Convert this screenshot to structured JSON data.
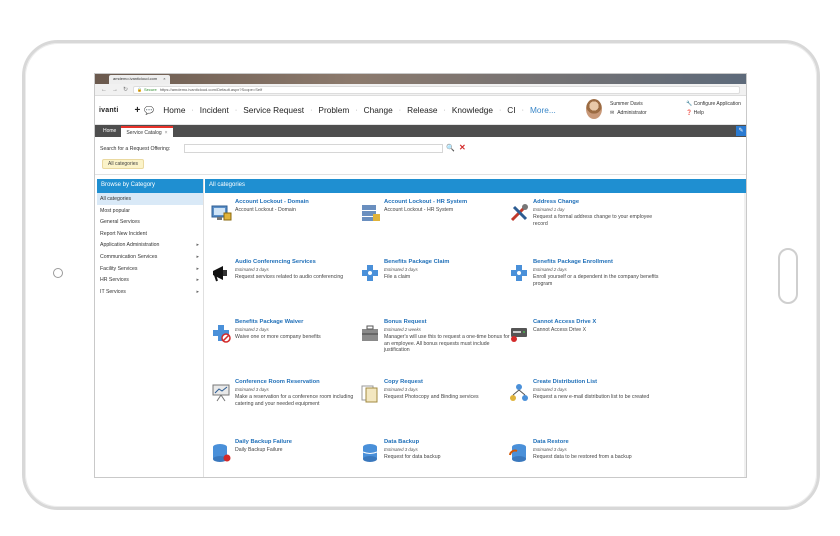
{
  "browser": {
    "tab_title": "amdemo.ivanticloud.com",
    "url_secure": "Secure",
    "url": "https://amdemo.ivanticloud.com/Default.aspx?Scope=Self"
  },
  "header": {
    "logo": "ivanti",
    "menu": [
      "Home",
      "Incident",
      "Service Request",
      "Problem",
      "Change",
      "Release",
      "Knowledge",
      "CI"
    ],
    "more": "More...",
    "user_name": "Summer Davis",
    "user_role": "Administrator",
    "configure": "Configure Application",
    "help": "Help"
  },
  "tabs": [
    {
      "label": "Home",
      "active": false
    },
    {
      "label": "Service Catalog",
      "active": true
    }
  ],
  "search": {
    "label": "Search for a Request Offering:",
    "value": "",
    "chip": "All categories"
  },
  "sidebar": {
    "title": "Browse by Category",
    "items": [
      {
        "label": "All categories",
        "selected": true,
        "arrow": false
      },
      {
        "label": "Most popular",
        "arrow": false
      },
      {
        "label": "General Services",
        "arrow": false
      },
      {
        "label": "Report New Incident",
        "arrow": false
      },
      {
        "label": "Application Administration",
        "arrow": true
      },
      {
        "label": "Communication Services",
        "arrow": true
      },
      {
        "label": "Facility Services",
        "arrow": true
      },
      {
        "label": "HR Services",
        "arrow": true
      },
      {
        "label": "IT Services",
        "arrow": true
      }
    ]
  },
  "main": {
    "title": "All categories",
    "offerings": [
      {
        "title": "Account Lockout - Domain",
        "est": "",
        "desc": "Account Lockout - Domain",
        "icon": "monitor-lock-icon"
      },
      {
        "title": "Account Lockout - HR System",
        "est": "",
        "desc": "Account Lockout - HR System",
        "icon": "server-lock-icon"
      },
      {
        "title": "Address Change",
        "est": "Estimated 1 day",
        "desc": "Request a formal address change to your employee record",
        "icon": "tools-icon"
      },
      {
        "title": "Audio Conferencing Services",
        "est": "Estimated 3 days",
        "desc": "Request services related to audio conferencing",
        "icon": "megaphone-icon"
      },
      {
        "title": "Benefits Package Claim",
        "est": "Estimated 3 days",
        "desc": "File a claim",
        "icon": "medical-icon"
      },
      {
        "title": "Benefits Package Enrollment",
        "est": "Estimated 2 days",
        "desc": "Enroll yourself or a dependent in the company benefits program",
        "icon": "medical-icon"
      },
      {
        "title": "Benefits Package Waiver",
        "est": "Estimated 2 days",
        "desc": "Waive one or more company benefits",
        "icon": "medical-cancel-icon"
      },
      {
        "title": "Bonus Request",
        "est": "Estimated 2 weeks",
        "desc": "Manager's will use this to request a one-time bonus for an employee. All bonus requests must include justification",
        "icon": "briefcase-icon"
      },
      {
        "title": "Cannot Access Drive X",
        "est": "",
        "desc": "Cannot Access Drive X",
        "icon": "drive-icon"
      },
      {
        "title": "Conference Room Reservation",
        "est": "Estimated 3 days",
        "desc": "Make a reservation for a conference room including catering and your needed equipment",
        "icon": "presentation-icon"
      },
      {
        "title": "Copy Request",
        "est": "Estimated 3 days",
        "desc": "Request Photocopy and Binding services",
        "icon": "documents-icon"
      },
      {
        "title": "Create Distribution List",
        "est": "Estimated 3 days",
        "desc": "Request a new e-mail distribution list to be created",
        "icon": "network-icon"
      },
      {
        "title": "Daily Backup Failure",
        "est": "",
        "desc": "Daily Backup Failure",
        "icon": "database-alert-icon"
      },
      {
        "title": "Data Backup",
        "est": "Estimated 3 days",
        "desc": "Request for data backup",
        "icon": "database-icon"
      },
      {
        "title": "Data Restore",
        "est": "Estimated 3 days",
        "desc": "Request data to be restored from a backup",
        "icon": "database-restore-icon"
      }
    ]
  },
  "colors": {
    "accent": "#1f8fd1",
    "link": "#1f6fb8",
    "tab_active_border": "#e8322a",
    "nav_bar": "#4e4e4e"
  }
}
